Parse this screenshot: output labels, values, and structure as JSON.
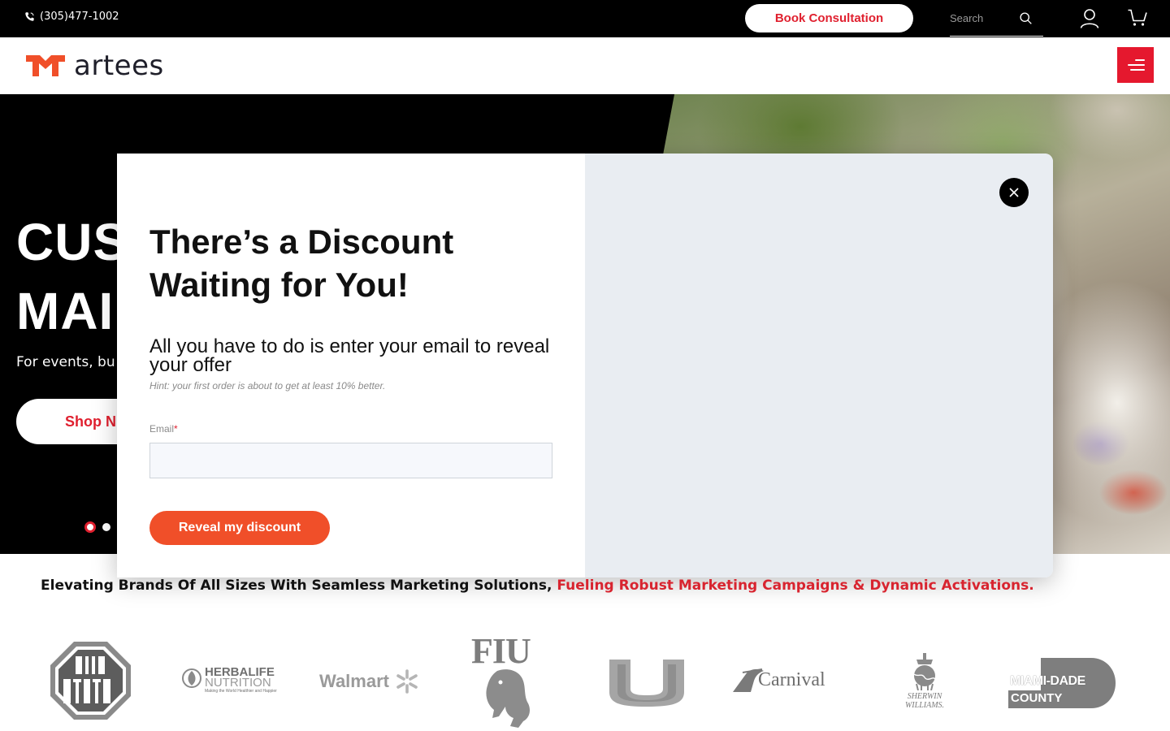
{
  "topbar": {
    "phone": "(305)477-1002",
    "book_label": "Book Consultation",
    "search_placeholder": "Search"
  },
  "header": {
    "logo_text": "artees"
  },
  "hero": {
    "title": "CUS\nMAI",
    "subtitle": "For events, bu",
    "cta_label": "Shop N",
    "slides_total": 3,
    "active_slide": 1
  },
  "modal": {
    "title": "There’s a Discount Waiting for You!",
    "description": "All you have to do is enter your email to reveal your offer",
    "hint": "Hint: your first order is about to get at least 10% better.",
    "email_label": "Email",
    "email_required_mark": "*",
    "email_value": "",
    "reveal_label": "Reveal my discount"
  },
  "tagline": {
    "black": "Elevating Brands Of All Sizes With Seamless Marketing Solutions,",
    "red": "Fueling Robust Marketing Campaigns & Dynamic Activations."
  },
  "clients": {
    "herbalife_name": "HERBALIFE",
    "herbalife_sub": "NUTRITION",
    "herbalife_tagline": "Making the World Healthier and Happier",
    "walmart": "Walmart",
    "fiu": "FIU",
    "carnival": "Carnival",
    "sherwin_line1": "SHERWIN",
    "sherwin_line2": "WILLIAMS.",
    "miami_line1": "MIAMI-DADE",
    "miami_line2": "COUNTY"
  },
  "colors": {
    "brand_red": "#e5182e",
    "cta_orange": "#f04f29",
    "tagline_red": "#d8242f"
  }
}
